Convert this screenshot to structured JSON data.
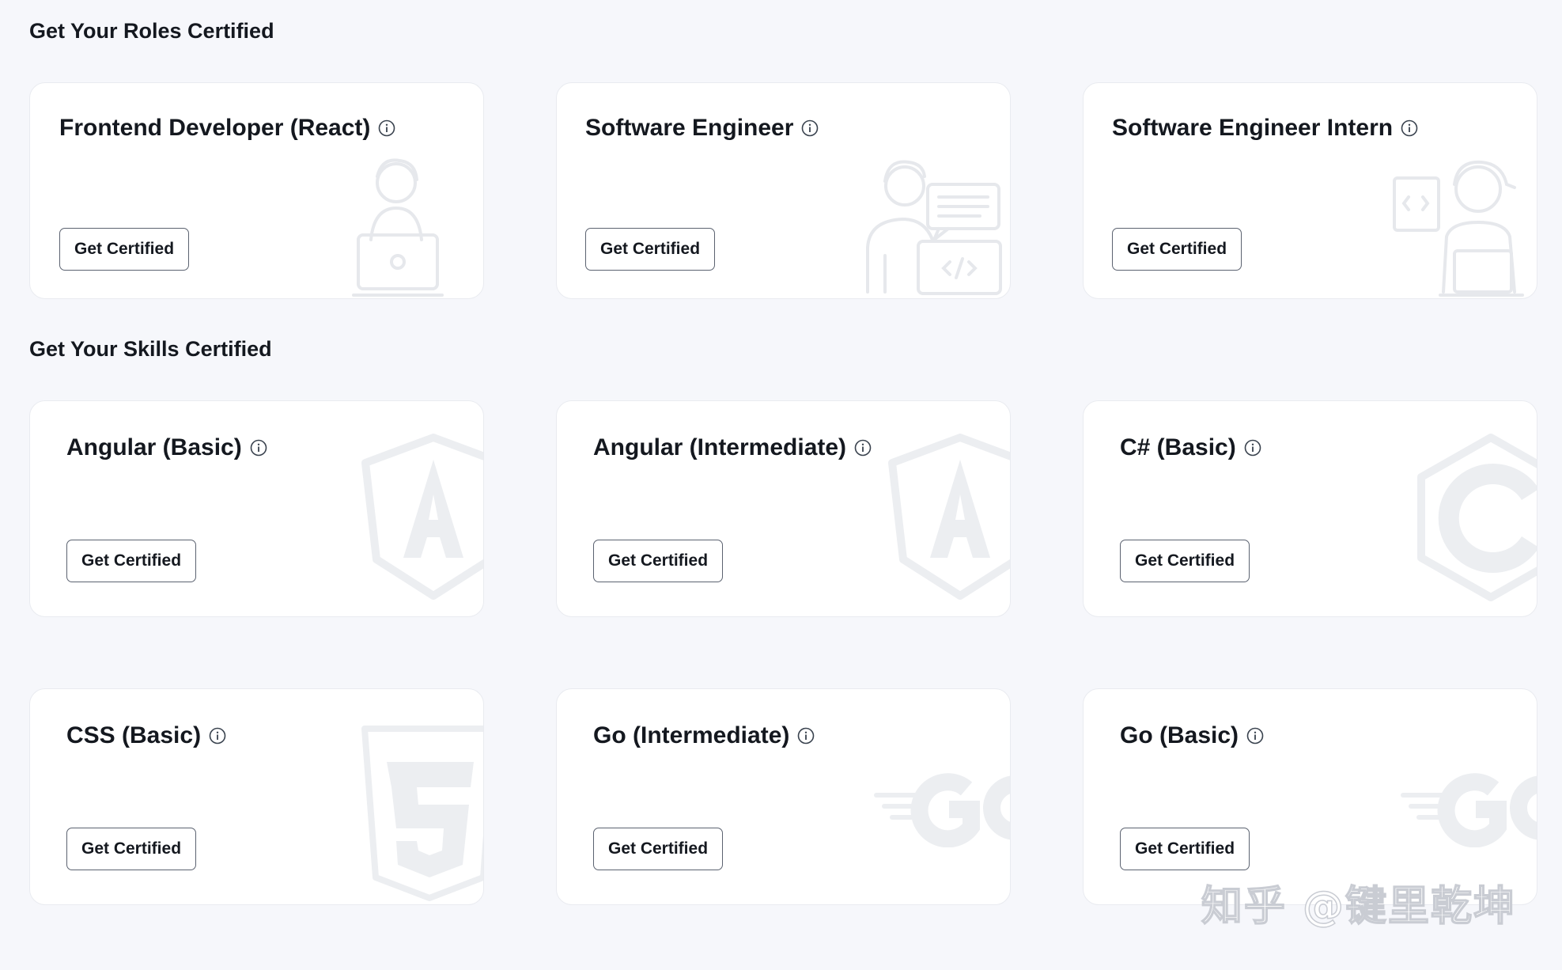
{
  "sections": {
    "roles_title": "Get Your Roles Certified",
    "skills_title": "Get Your Skills Certified"
  },
  "roles": [
    {
      "title": "Frontend Developer (React)",
      "button": "Get Certified",
      "illustration": "developer-laptop-icon"
    },
    {
      "title": "Software Engineer",
      "button": "Get Certified",
      "illustration": "engineer-code-icon"
    },
    {
      "title": "Software Engineer Intern",
      "button": "Get Certified",
      "illustration": "intern-laptop-icon"
    }
  ],
  "skills": [
    {
      "title": "Angular (Basic)",
      "button": "Get Certified",
      "illustration": "angular-logo-icon"
    },
    {
      "title": "Angular (Intermediate)",
      "button": "Get Certified",
      "illustration": "angular-logo-icon"
    },
    {
      "title": "C# (Basic)",
      "button": "Get Certified",
      "illustration": "csharp-logo-icon"
    },
    {
      "title": "CSS (Basic)",
      "button": "Get Certified",
      "illustration": "css3-logo-icon"
    },
    {
      "title": "Go (Intermediate)",
      "button": "Get Certified",
      "illustration": "go-logo-icon"
    },
    {
      "title": "Go (Basic)",
      "button": "Get Certified",
      "illustration": "go-logo-icon"
    }
  ],
  "watermark": "知乎 @键里乾坤",
  "colors": {
    "background": "#f6f7fb",
    "card": "#ffffff",
    "text": "#14181f",
    "button_border": "#5b6270",
    "illustration": "#e6e8ec"
  }
}
